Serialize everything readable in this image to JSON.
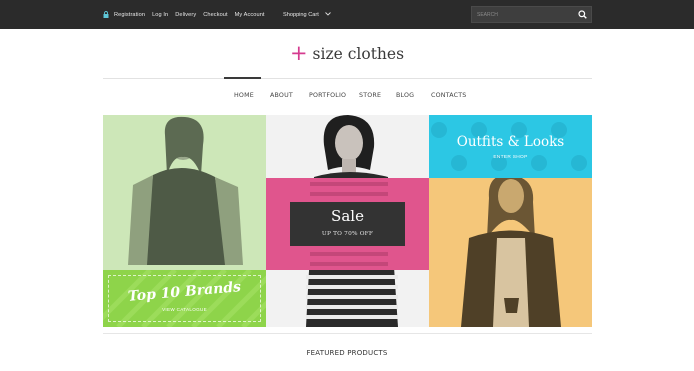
{
  "topbar": {
    "links": [
      "Registration",
      "Log In",
      "Delivery",
      "Checkout",
      "My Account"
    ],
    "cart_label": "Shopping Cart",
    "search_placeholder": "SEARCH",
    "icons": {
      "lock": "lock-icon",
      "cart_dropdown": "chevron-down-icon",
      "search": "search-icon"
    }
  },
  "logo": {
    "mark": "+",
    "name": "size clothes",
    "mark_color": "#d53b8f"
  },
  "nav": {
    "items": [
      "HOME",
      "ABOUT",
      "PORTFOLIO",
      "STORE",
      "BLOG",
      "CONTACTS"
    ],
    "active": "HOME"
  },
  "hero": {
    "brands": {
      "title": "Top 10 Brands",
      "subtitle": "VIEW CATALOGUE",
      "color": "#8ed44a"
    },
    "sale": {
      "title": "Sale",
      "subtitle": "UP TO 70% OFF",
      "band_color": "#e0558d"
    },
    "outfits": {
      "title": "Outfits & Looks",
      "subtitle": "ENTER SHOP",
      "color": "#2cc7e4"
    }
  },
  "featured": {
    "title": "FEATURED PRODUCTS"
  }
}
